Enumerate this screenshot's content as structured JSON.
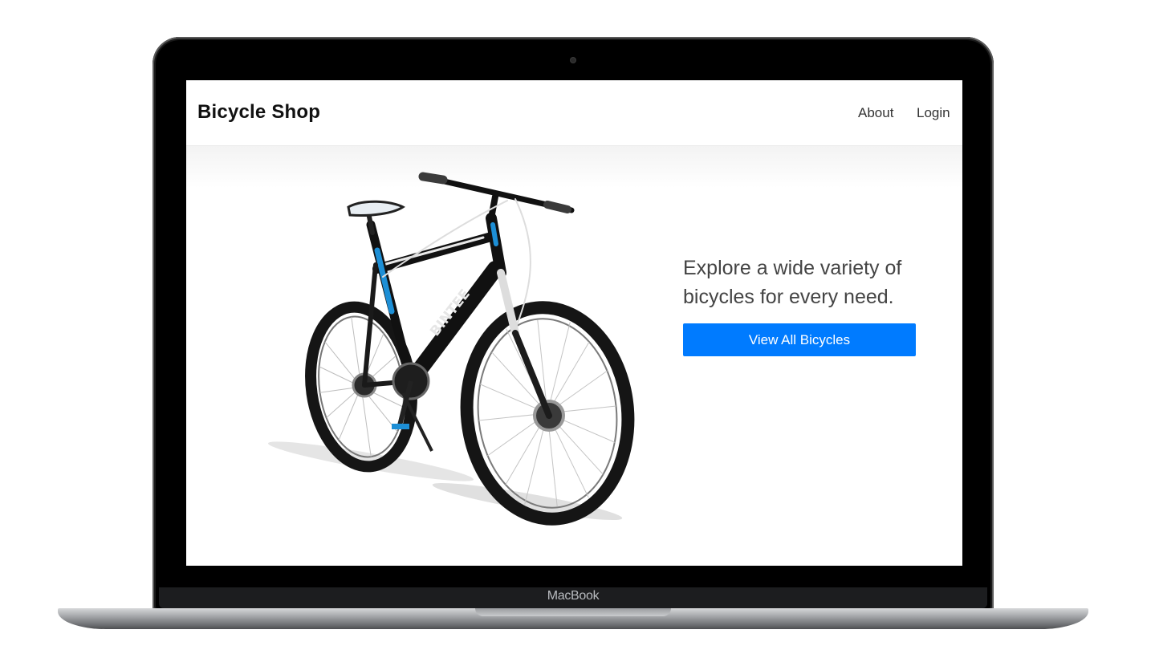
{
  "device": {
    "brand_label": "MacBook"
  },
  "navbar": {
    "logo": "Bicycle Shop",
    "links": [
      {
        "label": "About"
      },
      {
        "label": "Login"
      }
    ]
  },
  "hero": {
    "image_alt": "Mountain bicycle",
    "bike_decal": "BINTEE",
    "headline": "Explore a wide variety of bicycles for every need.",
    "cta_label": "View All Bicycles"
  },
  "colors": {
    "accent": "#007bff",
    "frame_black": "#000000",
    "bike_blue": "#1d8fd6"
  }
}
